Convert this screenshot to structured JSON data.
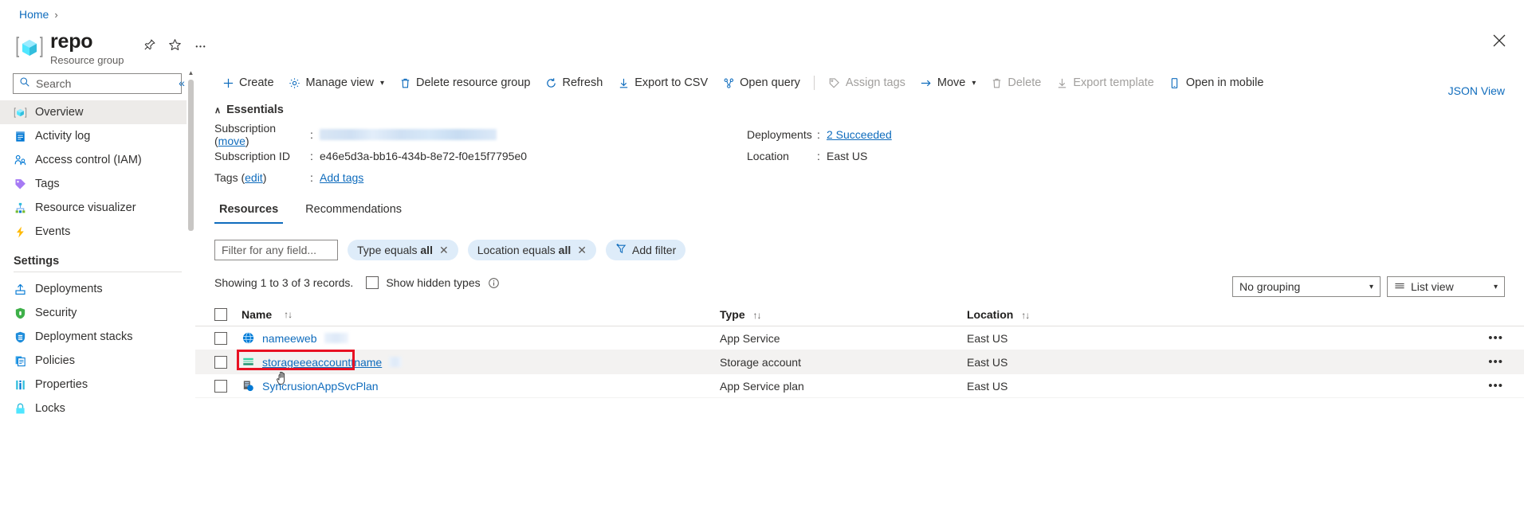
{
  "breadcrumb": {
    "home": "Home",
    "separator": "›"
  },
  "header": {
    "title": "repo",
    "subtitle": "Resource group",
    "pin_icon": "pin-icon",
    "favorite_icon": "star-icon",
    "more_icon": "ellipsis-icon",
    "close_icon": "close-icon"
  },
  "sidebar": {
    "search_placeholder": "Search",
    "collapse_label": "«",
    "items": [
      {
        "label": "Overview",
        "icon": "resource-group-icon",
        "selected": true
      },
      {
        "label": "Activity log",
        "icon": "activity-log-icon",
        "selected": false
      },
      {
        "label": "Access control (IAM)",
        "icon": "access-control-icon",
        "selected": false
      },
      {
        "label": "Tags",
        "icon": "tag-icon",
        "selected": false
      },
      {
        "label": "Resource visualizer",
        "icon": "resource-visualizer-icon",
        "selected": false
      },
      {
        "label": "Events",
        "icon": "events-icon",
        "selected": false
      }
    ],
    "group_label": "Settings",
    "settings_items": [
      {
        "label": "Deployments",
        "icon": "deployments-icon"
      },
      {
        "label": "Security",
        "icon": "security-shield-icon"
      },
      {
        "label": "Deployment stacks",
        "icon": "deployment-stacks-icon"
      },
      {
        "label": "Policies",
        "icon": "policies-icon"
      },
      {
        "label": "Properties",
        "icon": "properties-icon"
      },
      {
        "label": "Locks",
        "icon": "lock-icon"
      }
    ]
  },
  "toolbar": {
    "buttons": [
      {
        "label": "Create",
        "icon": "plus-icon",
        "disabled": false,
        "chevron": false
      },
      {
        "label": "Manage view",
        "icon": "gear-icon",
        "disabled": false,
        "chevron": true
      },
      {
        "label": "Delete resource group",
        "icon": "trash-icon",
        "disabled": false,
        "chevron": false
      },
      {
        "label": "Refresh",
        "icon": "refresh-icon",
        "disabled": false,
        "chevron": false
      },
      {
        "label": "Export to CSV",
        "icon": "download-icon",
        "disabled": false,
        "chevron": false
      },
      {
        "label": "Open query",
        "icon": "open-query-icon",
        "disabled": false,
        "chevron": false
      },
      {
        "label": "Assign tags",
        "icon": "tag-icon",
        "disabled": true,
        "chevron": false
      },
      {
        "label": "Move",
        "icon": "arrow-right-icon",
        "disabled": false,
        "chevron": true
      },
      {
        "label": "Delete",
        "icon": "trash-icon",
        "disabled": true,
        "chevron": false
      },
      {
        "label": "Export template",
        "icon": "download-icon",
        "disabled": true,
        "chevron": false
      },
      {
        "label": "Open in mobile",
        "icon": "mobile-icon",
        "disabled": false,
        "chevron": false
      }
    ]
  },
  "essentials": {
    "heading": "Essentials",
    "caret": "∧",
    "json_view": "JSON View",
    "subscription_label": "Subscription (",
    "subscription_move": "move",
    "subscription_label_end": ")",
    "subscription_value": "",
    "subscription_id_label": "Subscription ID",
    "subscription_id_value": "e46e5d3a-bb16-434b-8e72-f0e15f7795e0",
    "tags_label": "Tags (",
    "tags_edit": "edit",
    "tags_label_end": ")",
    "tags_value": "Add tags",
    "deployments_label": "Deployments",
    "deployments_value": "2 Succeeded",
    "location_label": "Location",
    "location_value": "East US",
    "colon": ":"
  },
  "tabs": [
    {
      "label": "Resources",
      "active": true
    },
    {
      "label": "Recommendations",
      "active": false
    }
  ],
  "filters": {
    "input_placeholder": "Filter for any field...",
    "pills": [
      {
        "text": "Type equals ",
        "bold": "all",
        "close": "✕"
      },
      {
        "text": "Location equals ",
        "bold": "all",
        "close": "✕"
      }
    ],
    "add_filter": "Add filter",
    "add_filter_icon": "add-filter-icon"
  },
  "records": {
    "showing": "Showing 1 to 3 of 3 records.",
    "show_hidden_types": "Show hidden types",
    "info_icon": "info-icon",
    "grouping_value": "No grouping",
    "view_value": "List view",
    "view_icon": "list-view-icon"
  },
  "table": {
    "columns": [
      {
        "label": "Name",
        "sort": "↑↓"
      },
      {
        "label": "Type",
        "sort": "↑↓"
      },
      {
        "label": "Location",
        "sort": "↑↓"
      }
    ],
    "rows": [
      {
        "name": "nameeweb",
        "icon": "app-service-icon",
        "type": "App Service",
        "location": "East US",
        "highlighted": false,
        "underline": false,
        "menu": "•••"
      },
      {
        "name": "storageeeaccounttname",
        "icon": "storage-account-icon",
        "type": "Storage account",
        "location": "East US",
        "highlighted": true,
        "underline": true,
        "menu": "•••"
      },
      {
        "name": "SyncrusionAppSvcPlan",
        "icon": "app-service-plan-icon",
        "type": "App Service plan",
        "location": "East US",
        "highlighted": false,
        "underline": false,
        "menu": "•••"
      }
    ]
  },
  "colors": {
    "accent": "#0f6cbd",
    "highlight_box": "#e81123",
    "pill_bg": "#deecf9",
    "row_selected_bg": "#f3f2f1",
    "border": "#e1dfdd"
  }
}
